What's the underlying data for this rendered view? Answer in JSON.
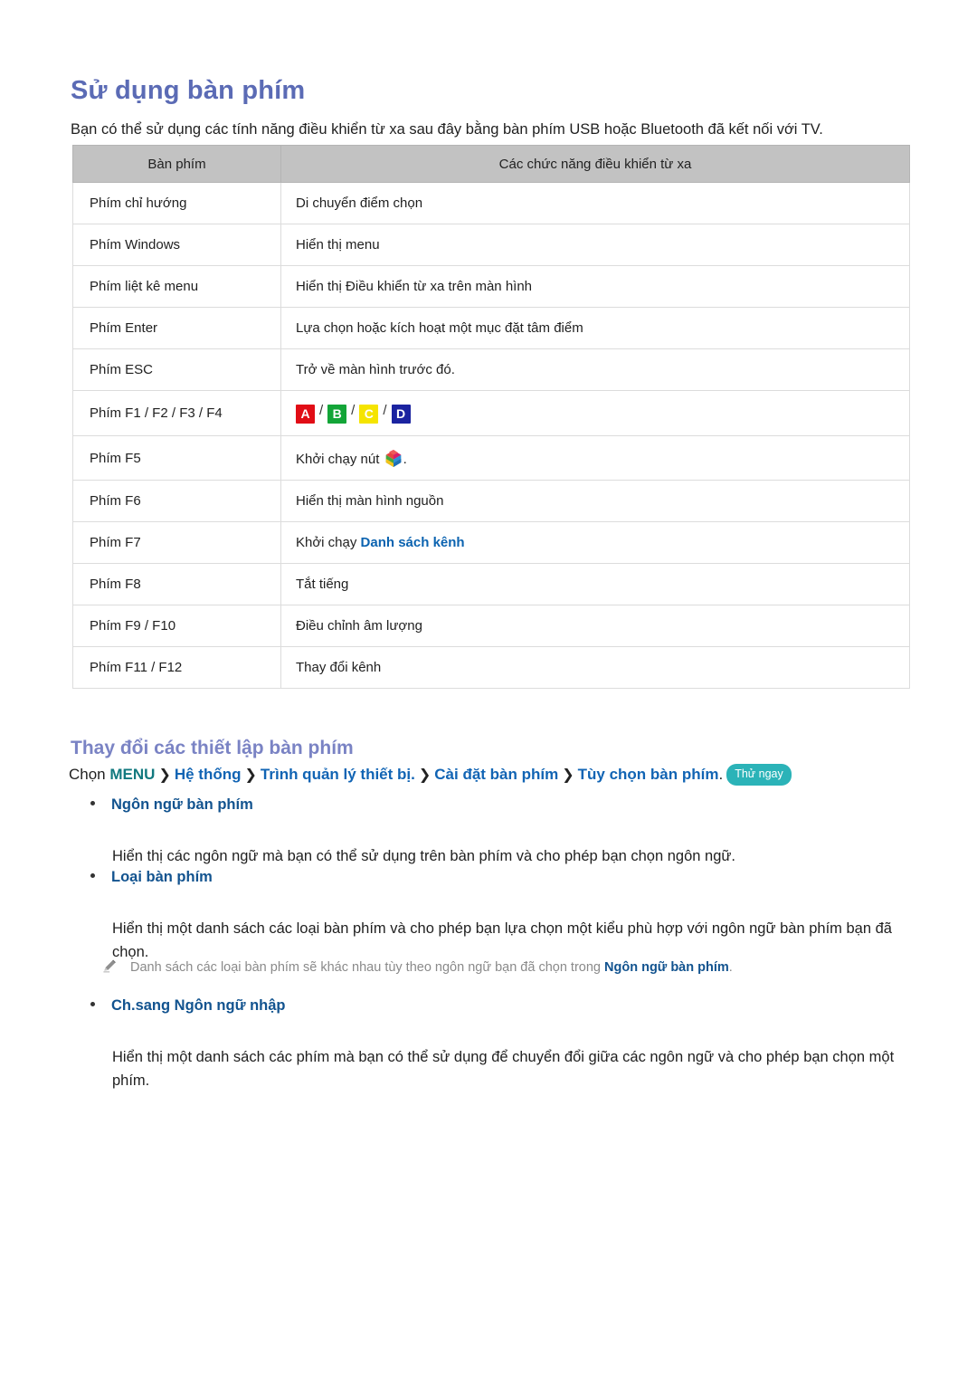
{
  "page": {
    "title": "Sử dụng bàn phím",
    "intro": "Bạn có thể sử dụng các tính năng điều khiển từ xa sau đây bằng bàn phím USB hoặc Bluetooth đã kết nối với TV."
  },
  "table": {
    "headers": [
      "Bàn phím",
      "Các chức năng điều khiển từ xa"
    ],
    "rows": [
      {
        "key": "Phím chỉ hướng",
        "func": "Di chuyển điểm chọn",
        "type": "text"
      },
      {
        "key": "Phím Windows",
        "func": "Hiển thị menu",
        "type": "text"
      },
      {
        "key": "Phím liệt kê menu",
        "func": "Hiển thị Điều khiển từ xa trên màn hình",
        "type": "text"
      },
      {
        "key": "Phím Enter",
        "func": "Lựa chọn hoặc kích hoạt một mục đặt tâm điểm",
        "type": "text"
      },
      {
        "key": "Phím ESC",
        "func": "Trở về màn hình trước đó.",
        "type": "text"
      },
      {
        "key": "Phím F1 / F2 / F3 / F4",
        "func": "",
        "type": "color-keys"
      },
      {
        "key": "Phím F5",
        "func": "Khởi chạy nút",
        "func_suffix": ".",
        "type": "cube"
      },
      {
        "key": "Phím F6",
        "func": "Hiển thị màn hình nguồn",
        "type": "text"
      },
      {
        "key": "Phím F7",
        "func": "Khởi chạy ",
        "func_link": "Danh sách kênh",
        "type": "link"
      },
      {
        "key": "Phím F8",
        "func": "Tắt tiếng",
        "type": "text"
      },
      {
        "key": "Phím F9 / F10",
        "func": "Điều chỉnh âm lượng",
        "type": "text"
      },
      {
        "key": "Phím F11 / F12",
        "func": "Thay đổi kênh",
        "type": "text"
      }
    ],
    "color_keys": [
      {
        "label": "A",
        "color": "#e10d16"
      },
      {
        "label": "B",
        "color": "#13a538"
      },
      {
        "label": "C",
        "color": "#f5e400"
      },
      {
        "label": "D",
        "color": "#1b23a0"
      }
    ],
    "color_key_separator": "/"
  },
  "settings": {
    "section_title": "Thay đổi các thiết lập bàn phím",
    "menu_path": {
      "prefix": "Chọn",
      "menu_label": "MENU",
      "chevron": "❯",
      "items": [
        "Hệ thống",
        "Trình quản lý thiết bị.",
        "Cài đặt bàn phím",
        "Tùy chọn bàn phím"
      ],
      "trailing_period": ".",
      "try_badge": "Thử ngay"
    },
    "bullets": [
      {
        "heading": "Ngôn ngữ bàn phím",
        "body": "Hiển thị các ngôn ngữ mà bạn có thể sử dụng trên bàn phím và cho phép bạn chọn ngôn ngữ."
      },
      {
        "heading": "Loại bàn phím",
        "body": "Hiển thị một danh sách các loại bàn phím và cho phép bạn lựa chọn một kiểu phù hợp với ngôn ngữ bàn phím bạn đã chọn."
      },
      {
        "heading": "Ch.sang Ngôn ngữ nhập",
        "body": " Hiển thị một danh sách các phím mà bạn có thể sử dụng để chuyển đổi giữa các ngôn ngữ và cho phép bạn chọn một phím."
      }
    ],
    "note": {
      "icon": "pencil-icon",
      "text_before": "Danh sách các loại bàn phím sẽ khác nhau tùy theo ngôn ngữ bạn đã chọn trong ",
      "text_strong": "Ngôn ngữ bàn phím",
      "text_after": "."
    }
  },
  "colors": {
    "title": "#5b6bb5",
    "section_title": "#7a83c4",
    "link": "#12538f",
    "menu_teal": "#12797f",
    "menu_blue": "#1164b4",
    "badge": "#2bb3b8",
    "table_header_bg": "#c2c2c2"
  }
}
